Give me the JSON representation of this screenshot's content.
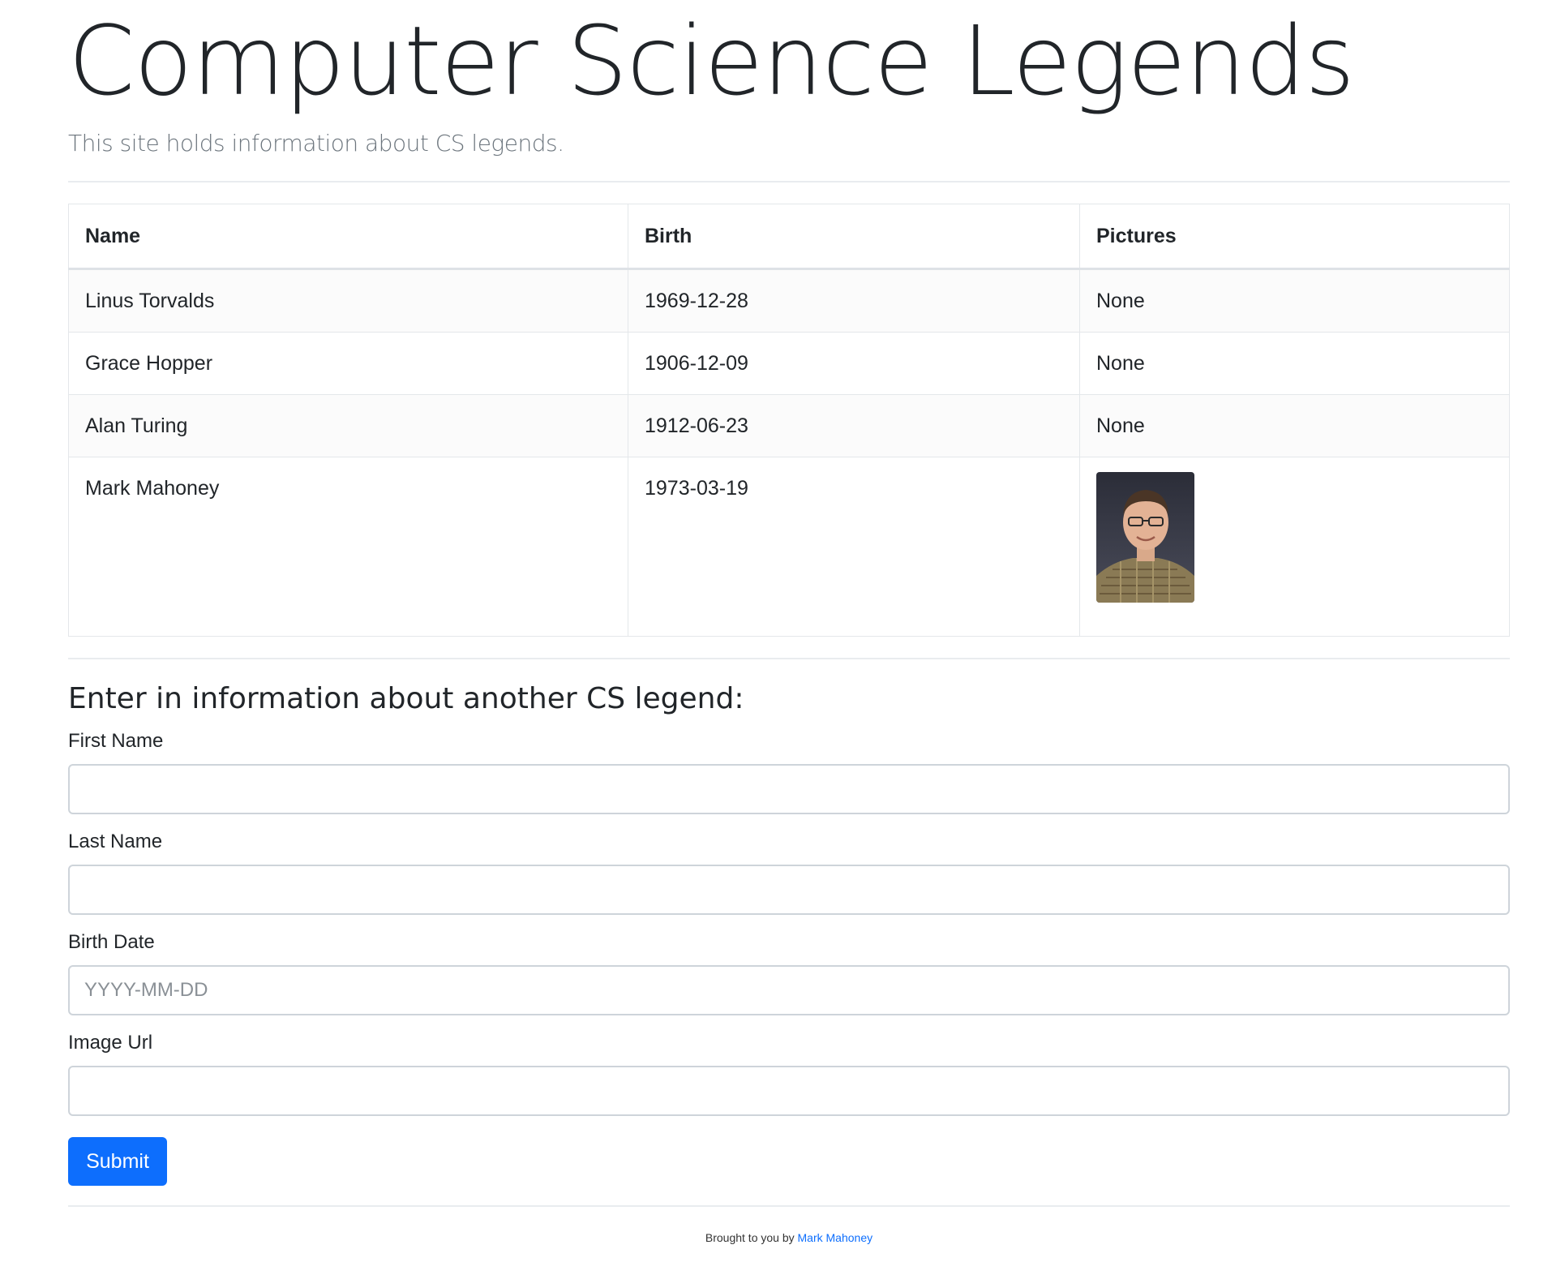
{
  "header": {
    "title": "Computer Science Legends",
    "lead": "This site holds information about CS legends."
  },
  "table": {
    "headers": [
      "Name",
      "Birth",
      "Pictures"
    ],
    "rows": [
      {
        "name": "Linus Torvalds",
        "birth": "1969-12-28",
        "picture": "None"
      },
      {
        "name": "Grace Hopper",
        "birth": "1906-12-09",
        "picture": "None"
      },
      {
        "name": "Alan Turing",
        "birth": "1912-06-23",
        "picture": "None"
      },
      {
        "name": "Mark Mahoney",
        "birth": "1973-03-19",
        "picture": "photo"
      }
    ]
  },
  "form": {
    "heading": "Enter in information about another CS legend:",
    "first_name": {
      "label": "First Name",
      "value": "",
      "placeholder": ""
    },
    "last_name": {
      "label": "Last Name",
      "value": "",
      "placeholder": ""
    },
    "birth_date": {
      "label": "Birth Date",
      "value": "",
      "placeholder": "YYYY-MM-DD"
    },
    "image_url": {
      "label": "Image Url",
      "value": "",
      "placeholder": ""
    },
    "submit_label": "Submit"
  },
  "footer": {
    "prefix": "Brought to you by ",
    "link_text": "Mark Mahoney"
  },
  "colors": {
    "primary": "#0d6efd",
    "muted_text": "#6c757d",
    "border": "#dee2e6"
  },
  "icons": {
    "portrait": "portrait-photo-icon"
  }
}
